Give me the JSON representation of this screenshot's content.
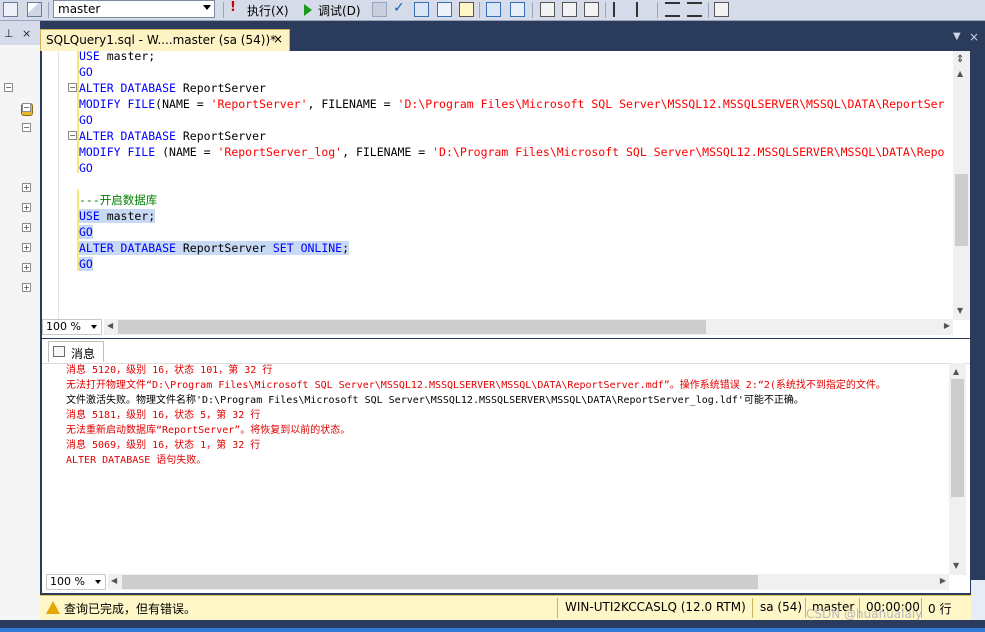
{
  "toolbar": {
    "database": "master",
    "execute_label": "执行(X)",
    "debug_label": "调试(D)"
  },
  "document_tab": {
    "title": "SQLQuery1.sql - W....master (sa (54))*",
    "close": "×"
  },
  "editor": {
    "lines": [
      {
        "parts": [
          {
            "t": "USE ",
            "c": "kw"
          },
          {
            "t": "master;",
            "c": "plain"
          }
        ]
      },
      {
        "parts": [
          {
            "t": "GO",
            "c": "kw"
          }
        ]
      },
      {
        "parts": [
          {
            "t": "ALTER DATABASE ",
            "c": "kw"
          },
          {
            "t": "ReportServer",
            "c": "plain"
          }
        ]
      },
      {
        "parts": [
          {
            "t": "MODIFY FILE",
            "c": "kw"
          },
          {
            "t": "(NAME = ",
            "c": "plain"
          },
          {
            "t": "'ReportServer'",
            "c": "str"
          },
          {
            "t": ", FILENAME = ",
            "c": "plain"
          },
          {
            "t": "'D:\\Program Files\\Microsoft SQL Server\\MSSQL12.MSSQLSERVER\\MSSQL\\DATA\\ReportSer",
            "c": "str"
          }
        ]
      },
      {
        "parts": [
          {
            "t": "GO",
            "c": "kw"
          }
        ]
      },
      {
        "parts": [
          {
            "t": "ALTER DATABASE ",
            "c": "kw"
          },
          {
            "t": "ReportServer",
            "c": "plain"
          }
        ]
      },
      {
        "parts": [
          {
            "t": "MODIFY FILE ",
            "c": "kw"
          },
          {
            "t": "(NAME = ",
            "c": "plain"
          },
          {
            "t": "'ReportServer_log'",
            "c": "str"
          },
          {
            "t": ", FILENAME = ",
            "c": "plain"
          },
          {
            "t": "'D:\\Program Files\\Microsoft SQL Server\\MSSQL12.MSSQLSERVER\\MSSQL\\DATA\\Repo",
            "c": "str"
          }
        ]
      },
      {
        "parts": [
          {
            "t": "GO",
            "c": "kw"
          }
        ]
      },
      {
        "parts": []
      },
      {
        "parts": [
          {
            "t": "---开启数据库",
            "c": "cmt"
          }
        ]
      },
      {
        "parts": [
          {
            "t": "USE ",
            "c": "kw"
          },
          {
            "t": "master;",
            "c": "plain"
          }
        ],
        "sel": true
      },
      {
        "parts": [
          {
            "t": "GO",
            "c": "kw"
          }
        ],
        "sel": true
      },
      {
        "parts": [
          {
            "t": "ALTER DATABASE ",
            "c": "kw"
          },
          {
            "t": "ReportServer ",
            "c": "plain"
          },
          {
            "t": "SET ONLINE",
            "c": "kw"
          },
          {
            "t": ";",
            "c": "plain"
          }
        ],
        "sel": true
      },
      {
        "parts": [
          {
            "t": "GO",
            "c": "kw"
          }
        ],
        "sel": true
      }
    ],
    "zoom": "100 %"
  },
  "results": {
    "tab_label": "消息",
    "messages": [
      {
        "text": "消息 5120，级别 16，状态 101，第 32 行",
        "color": "red"
      },
      {
        "text": "无法打开物理文件“D:\\Program Files\\Microsoft SQL Server\\MSSQL12.MSSQLSERVER\\MSSQL\\DATA\\ReportServer.mdf”。操作系统错误 2:“2(系统找不到指定的文件。",
        "color": "red"
      },
      {
        "text": "文件激活失败。物理文件名称'D:\\Program Files\\Microsoft SQL Server\\MSSQL12.MSSQLSERVER\\MSSQL\\DATA\\ReportServer_log.ldf'可能不正确。",
        "color": "black"
      },
      {
        "text": "消息 5181，级别 16，状态 5，第 32 行",
        "color": "red"
      },
      {
        "text": "无法重新启动数据库“ReportServer”。将恢复到以前的状态。",
        "color": "red"
      },
      {
        "text": "消息 5069，级别 16，状态 1，第 32 行",
        "color": "red"
      },
      {
        "text": "ALTER DATABASE 语句失败。",
        "color": "red"
      }
    ],
    "zoom": "100 %"
  },
  "status": {
    "message": "查询已完成，但有错误。",
    "server": "WIN-UTI2KCCASLQ (12.0 RTM)",
    "user": "sa (54)",
    "database": "master",
    "elapsed": "00:00:00",
    "rows": "0 行"
  },
  "watermark": "CSDN @huahualaly"
}
